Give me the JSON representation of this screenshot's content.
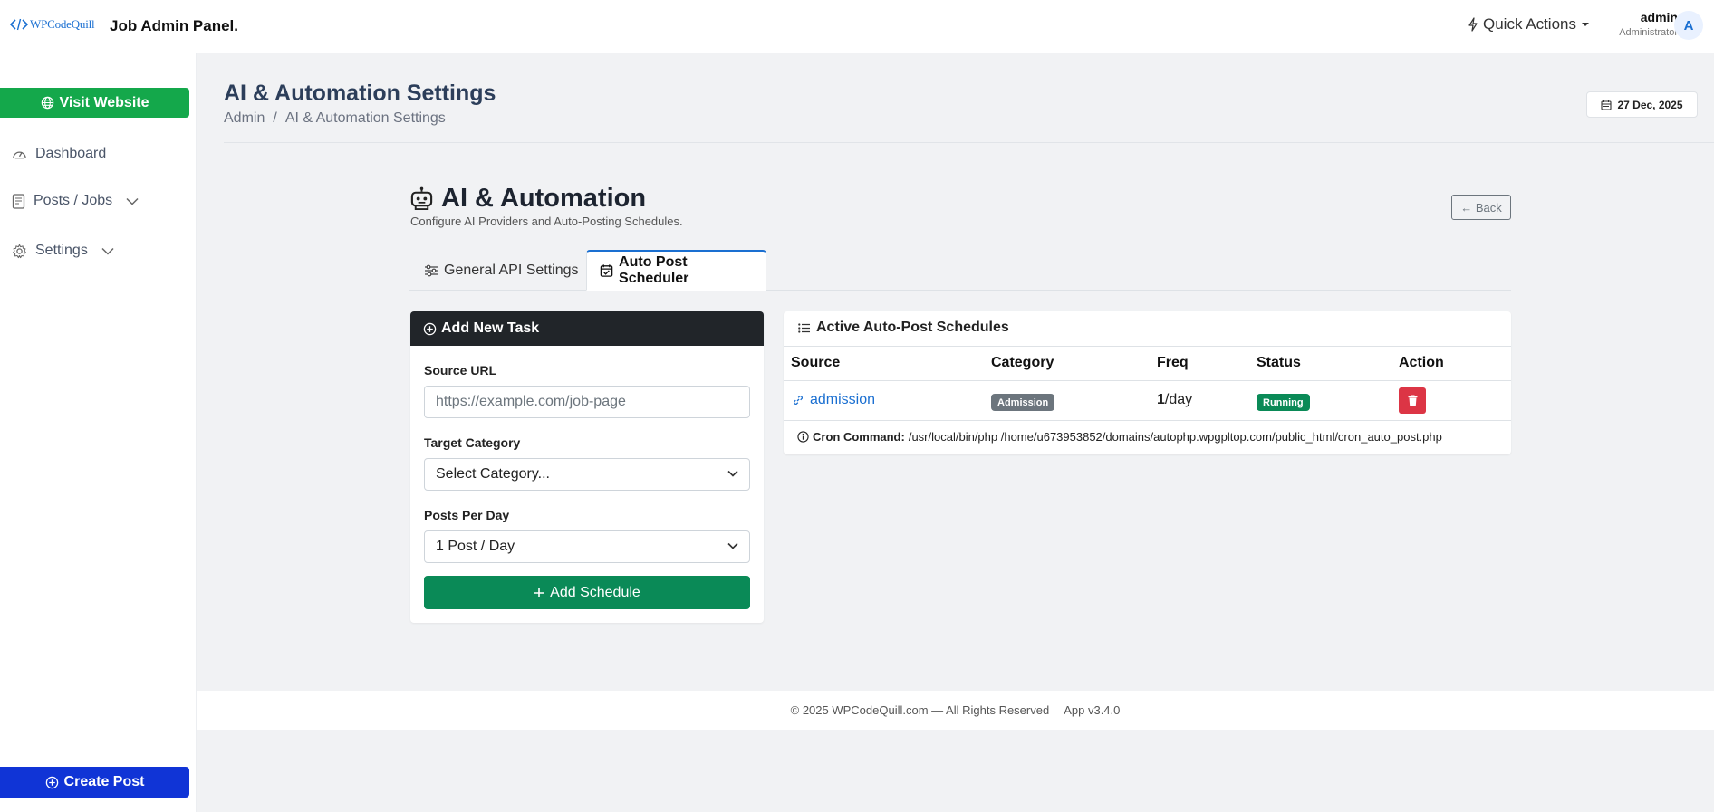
{
  "header": {
    "logo_text": "WPCodeQuill",
    "brand_title": "Job Admin Panel.",
    "quick_actions_label": "Quick Actions",
    "user_name": "admin",
    "user_role": "Administrator",
    "avatar_letter": "A"
  },
  "sidebar": {
    "visit_label": "Visit Website",
    "items": [
      {
        "label": "Dashboard",
        "icon": "speedometer-icon"
      },
      {
        "label": "Posts / Jobs",
        "icon": "document-icon",
        "expandable": true
      },
      {
        "label": "Settings",
        "icon": "gear-icon",
        "expandable": true
      }
    ],
    "create_label": "Create Post"
  },
  "page": {
    "title": "AI & Automation Settings",
    "breadcrumb": [
      "Admin",
      "/",
      "AI & Automation Settings"
    ],
    "date": "27 Dec, 2025"
  },
  "section": {
    "title": "AI & Automation",
    "subtitle": "Configure AI Providers and Auto-Posting Schedules.",
    "back_label": "← Back"
  },
  "tabs": [
    {
      "label": "General API Settings",
      "icon": "sliders-icon",
      "active": false
    },
    {
      "label": "Auto Post Scheduler",
      "icon": "calendar-check-icon",
      "active": true
    }
  ],
  "task_form": {
    "header": "Add New Task",
    "source_url_label": "Source URL",
    "source_url_placeholder": "https://example.com/job-page",
    "source_url_value": "",
    "category_label": "Target Category",
    "category_value": "Select Category...",
    "posts_label": "Posts Per Day",
    "posts_value": "1 Post / Day",
    "submit_label": "Add Schedule"
  },
  "schedules": {
    "header": "Active Auto-Post Schedules",
    "columns": [
      "Source",
      "Category",
      "Freq",
      "Status",
      "Action"
    ],
    "rows": [
      {
        "source": "admission",
        "category": "Admission",
        "freq_count": "1",
        "freq_unit": "/day",
        "status": "Running"
      }
    ],
    "cron_label": "Cron Command:",
    "cron_value": "/usr/local/bin/php /home/u673953852/domains/autophp.wpgpltop.com/public_html/cron_auto_post.php"
  },
  "footer": {
    "copyright": "© 2025 WPCodeQuill.com — All Rights Reserved",
    "version": "App v3.4.0"
  },
  "colors": {
    "visit_green": "#14a84b",
    "create_blue": "#1034d6",
    "task_header_dark": "#212529",
    "add_schedule_green": "#0a8a57",
    "delete_red": "#dc3545",
    "link_blue": "#1a6fd1",
    "category_badge_gray": "#6c757d"
  }
}
